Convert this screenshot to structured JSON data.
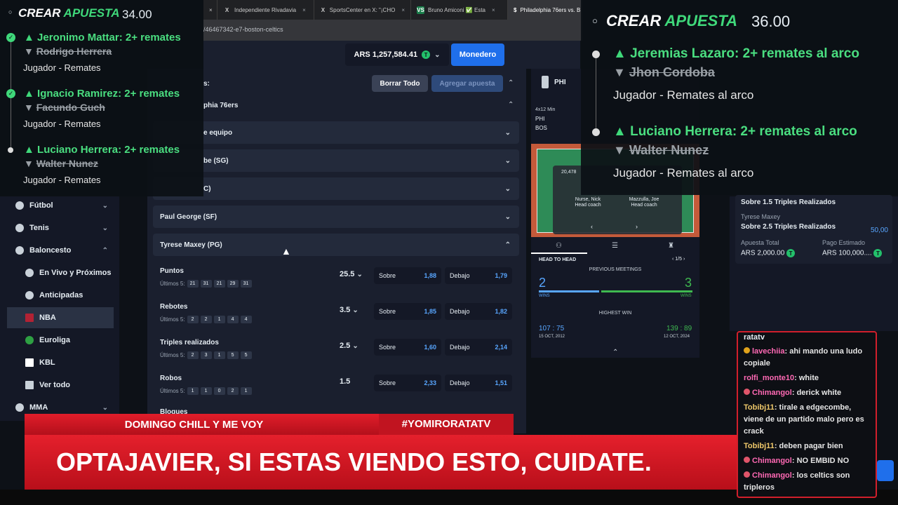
{
  "browser": {
    "tabs": [
      {
        "icon": "",
        "label": "",
        "close": "×"
      },
      {
        "icon": "X",
        "label": "Independiente Rivadavia",
        "close": "×"
      },
      {
        "icon": "X",
        "label": "SportsCenter en X: \"¡CHO",
        "close": "×"
      },
      {
        "icon": "VS",
        "label": "Bruno Amiconi ✅ Esta",
        "close": "×"
      },
      {
        "icon": "$",
        "label": "Philadelphia 76ers vs. B",
        "close": ""
      }
    ],
    "url": "/46467342-e7-boston-celtics"
  },
  "header": {
    "balance": "ARS 1,257,584.41",
    "coin": "T",
    "wallet_label": "Monedero"
  },
  "slip_left": {
    "title_a": "CREAR",
    "title_b": "APUESTA",
    "odds": "34.00",
    "legs": [
      {
        "player": "Jeronimo Mattar: 2+ remates",
        "opponent": "Rodrigo Herrera",
        "market": "Jugador - Remates"
      },
      {
        "player": "Ignacio Ramirez: 2+ remates",
        "opponent": "Facundo Guch",
        "market": "Jugador - Remates"
      },
      {
        "player": "Luciano Herrera: 2+ remates",
        "opponent": "Walter Nunez",
        "market": "Jugador - Remates"
      }
    ]
  },
  "slip_right": {
    "title_a": "CREAR",
    "title_b": "APUESTA",
    "odds": "36.00",
    "legs": [
      {
        "player": "Jeremias Lazaro: 2+ remates al arco",
        "opponent": "Jhon Cordoba",
        "market": "Jugador - Remates al arco"
      },
      {
        "player": "Luciano Herrera: 2+ remates al arco",
        "opponent": "Walter Nunez",
        "market": "Jugador - Remates al arco"
      }
    ]
  },
  "nav": {
    "items": [
      {
        "label": "Fútbol",
        "chev": "⌄"
      },
      {
        "label": "Tenis",
        "chev": "⌄"
      },
      {
        "label": "Baloncesto",
        "chev": "⌃"
      },
      {
        "label": "En Vivo y Próximos"
      },
      {
        "label": "Anticipadas"
      },
      {
        "label": "NBA"
      },
      {
        "label": "Euroliga"
      },
      {
        "label": "KBL"
      },
      {
        "label": "Ver todo"
      },
      {
        "label": "MMA",
        "chev": "⌄"
      }
    ]
  },
  "main": {
    "header_fragment": "s:",
    "clear_label": "Borrar Todo",
    "add_label": "Agregar apuesta",
    "team_fragment": "phia 76ers",
    "rows": [
      "e equipo",
      "be (SG)",
      "C)",
      "Paul George (SF)",
      "Tyrese Maxey (PG)"
    ],
    "over_label": "Sobre",
    "under_label": "Debajo",
    "last5_label": "Últimos 5:",
    "stats": [
      {
        "name": "Puntos",
        "last5": [
          "21",
          "31",
          "21",
          "29",
          "31"
        ],
        "line": "25.5",
        "over": "1,88",
        "under": "1,79"
      },
      {
        "name": "Rebotes",
        "last5": [
          "2",
          "2",
          "1",
          "4",
          "4"
        ],
        "line": "3.5",
        "over": "1,85",
        "under": "1,82"
      },
      {
        "name": "Triples realizados",
        "last5": [
          "2",
          "3",
          "1",
          "5",
          "5"
        ],
        "line": "2.5",
        "over": "1,60",
        "under": "2,14"
      },
      {
        "name": "Robos",
        "last5": [
          "1",
          "1",
          "0",
          "2",
          "1"
        ],
        "line": "1.5",
        "over": "2,33",
        "under": "1,51"
      }
    ],
    "next_fragment": "Bloques"
  },
  "tracker": {
    "team_abbr": "PHI",
    "period": "4x12 Min",
    "team1": "PHI",
    "team2": "BOS",
    "court_value": "20,478",
    "coach1_name": "Nurse, Nick",
    "coach1_role": "Head coach",
    "coach2_name": "Mazzulla, Joe",
    "coach2_role": "Head coach",
    "h2h_label": "HEAD TO HEAD",
    "pager": "1/5",
    "prev_label": "PREVIOUS MEETINGS",
    "wins_left": "2",
    "wins_right": "3",
    "wins_label": "WINS",
    "highest_label": "HIGHEST WIN",
    "score_left": "107 : 75",
    "date_left": "15 OCT, 2012",
    "score_right": "139 : 89",
    "date_right": "12 OCT, 2024"
  },
  "summary": {
    "line1": "Sobre 1.5 Triples Realizados",
    "player": "Tyrese Maxey",
    "line2": "Sobre 2.5 Triples Realizados",
    "odds": "50,00",
    "stake_label": "Apuesta Total",
    "stake": "ARS 2,000.00",
    "payout_label": "Pago Estimado",
    "payout": "ARS 100,000...."
  },
  "banners": {
    "left": "DOMINGO CHILL Y ME VOY",
    "right": "#YOMIRORATATV",
    "main": "OPTAJAVIER, SI ESTAS VIENDO ESTO, CUIDATE."
  },
  "chat": {
    "channel": "ratatv",
    "messages": [
      {
        "user": "lavechiia",
        "text": ": ahi mando una ludo copiale",
        "color": "#ff69b4"
      },
      {
        "user": "rolfi_monte10",
        "text": ": white",
        "color": "#ff69b4"
      },
      {
        "user": "Chimangol",
        "text": ": derick white",
        "color": "#ff69b4"
      },
      {
        "user": "Tobibj11",
        "text": ": tirale a edgecombe, viene de un partido malo pero es crack",
        "color": "#f0c96a"
      },
      {
        "user": "Tobibj11",
        "text": ": deben pagar bien",
        "color": "#f0c96a"
      },
      {
        "user": "Chimangol",
        "text": ": NO EMBID NO",
        "color": "#ff69b4"
      },
      {
        "user": "Chimangol",
        "text": ": los celtics son tripleros",
        "color": "#ff69b4"
      }
    ]
  }
}
